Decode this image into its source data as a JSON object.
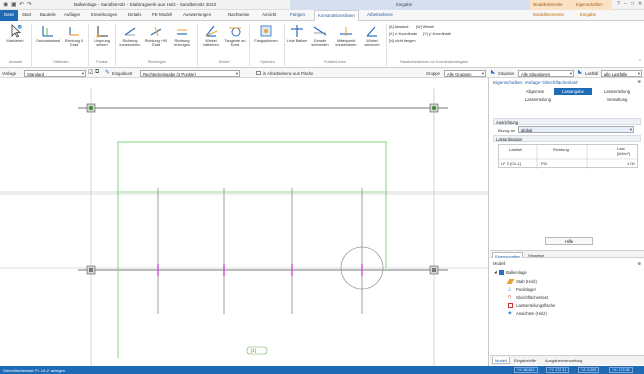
{
  "window": {
    "title": "Balkenlage - SandbsHolz - Stabtragwerk aus Holz - SandbsHolz 2023",
    "context_group_1": "Eingabe",
    "context_group_2": "Modellelemente",
    "context_group_3": "Eigenschaften",
    "controls": [
      "?",
      "–",
      "□",
      "✕"
    ]
  },
  "tabs": [
    "Datei",
    "Start",
    "Bauteile",
    "Auflager",
    "Einwirkungen",
    "Details",
    "FE-Modell",
    "Auswertungen",
    "Nachweise",
    "Ansicht",
    "Fangen",
    "Konstruktionslinien",
    "Arbeitsebene",
    "Modellelemente",
    "Eingabe"
  ],
  "ribbon": {
    "buttons": [
      {
        "label": "Markieren",
        "sub": "⌄"
      },
      {
        "label": "Grundabstand"
      },
      {
        "label": "Richtung 0 Grad"
      },
      {
        "label": "Ursprung setzen"
      },
      {
        "label": "Richtung konstruieren"
      },
      {
        "label": "Richtung +90 Grad"
      },
      {
        "label": "Richtung erzeugen"
      },
      {
        "label": "Winkel halbieren"
      },
      {
        "label": "Tangente an Kreis"
      },
      {
        "label": "Fangoptionen"
      },
      {
        "label": "Linie Balken"
      },
      {
        "label": "Gerade schneiden"
      },
      {
        "label": "Mittelpunkt konstruieren"
      },
      {
        "label": "Winkel zeichnen"
      }
    ],
    "small_items": [
      "[A] Abstand",
      "[W] Winkel",
      "[X] x'-Koordinate",
      "[Y] y'-Koordinate",
      "[N] nicht fangen"
    ],
    "groups": [
      "Auswahl",
      "Hilfslinien",
      "Punkte",
      "Richtungen",
      "Winkel",
      "Geraden und Kreise",
      "Optionen",
      "Punkte/Linien",
      "Tastaturfunktionen zur Koordinateneingabe"
    ]
  },
  "toolbar": {
    "vorlage_label": "Vorlage",
    "vorlage_value": "Standard",
    "eingabeart_label": "Eingabeart",
    "eingabeart_value": "Rechteckeingabe (2 Punkte)",
    "checkbox_label": "in Arbeitsebene aus Fläche",
    "gruppe_label": "Gruppe",
    "gruppe_value": "Alle Gruppen",
    "situation_label": "Situation",
    "situation_value": "Alle Situationen",
    "lastfall_label": "Lastfall",
    "lastfall_value": "alle Lastfälle"
  },
  "canvas": {
    "dimension_label": "[1]"
  },
  "properties": {
    "header": "Eigenschaften: Vorlage 'Gleichflächenlast'",
    "tabs_row1": [
      "Allgemein",
      "Lastangabe",
      "Lastverteilung"
    ],
    "tabs_row2": [
      "Lastverteilung",
      "Verwaltung"
    ],
    "section1": "Ausrichtung",
    "bezug_label": "Bezug an",
    "bezug_value": "global",
    "section2": "Lastordination",
    "table_headers": [
      "Lastfall",
      "Richtung",
      "Last [kN/m²]"
    ],
    "table_row": {
      "lastfall": "LF 2 [Ch.1]",
      "richtung": "PZr",
      "last": "1.00"
    },
    "help": "Hilfe"
  },
  "panel_tabs": [
    "Eigenschaften",
    "Hinweise"
  ],
  "model": {
    "title": "Modell",
    "root": "Balkenlage",
    "items": [
      "Stab (Holz)",
      "Punktlager",
      "Gleichflächenlast",
      "Lastverteilungsfläche",
      "Ansichten (Holz)"
    ]
  },
  "bottom_tabs": [
    "Modell",
    "Eingabehilfe",
    "Ausgabenverwaltung"
  ],
  "status": {
    "text": "Gleichflächenlast 'Fl. Lft-2' anlegen",
    "boxes": [
      "+X: 58.843",
      "+Y: 172.31",
      "+Z: 0.000",
      "+X: 172.05"
    ]
  }
}
